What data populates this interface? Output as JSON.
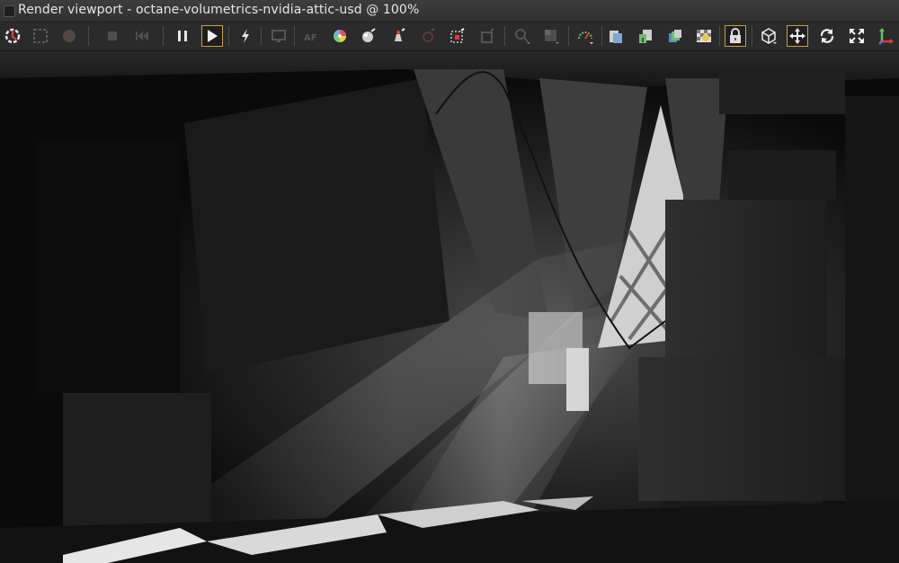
{
  "window": {
    "title": "Render viewport - octane-volumetrics-nvidia-attic-usd @ 100%"
  },
  "toolbar": {
    "buttons": [
      {
        "name": "reset-camera-icon",
        "state": "enabled"
      },
      {
        "name": "region-render-icon",
        "state": "disabled"
      },
      {
        "name": "film-region-icon",
        "state": "disabled"
      },
      {
        "name": "stop-render-icon",
        "state": "disabled"
      },
      {
        "name": "restart-render-icon",
        "state": "disabled"
      },
      {
        "name": "pause-render-icon",
        "state": "enabled"
      },
      {
        "name": "start-render-icon",
        "state": "selected"
      },
      {
        "name": "fast-preview-icon",
        "state": "enabled"
      },
      {
        "name": "display-settings-icon",
        "state": "disabled"
      },
      {
        "name": "autofocus-icon",
        "state": "disabled"
      },
      {
        "name": "white-balance-icon",
        "state": "enabled"
      },
      {
        "name": "material-picker-icon",
        "state": "enabled"
      },
      {
        "name": "object-picker-icon",
        "state": "enabled"
      },
      {
        "name": "light-picker-icon",
        "state": "disabled"
      },
      {
        "name": "render-region-picker-icon",
        "state": "enabled"
      },
      {
        "name": "camera-target-picker-icon",
        "state": "disabled"
      },
      {
        "name": "viewport-resolution-icon",
        "state": "disabled"
      },
      {
        "name": "background-icon",
        "state": "disabled"
      },
      {
        "name": "render-priority-icon",
        "state": "enabled"
      },
      {
        "name": "copy-to-clipboard-icon",
        "state": "enabled"
      },
      {
        "name": "save-render-icon",
        "state": "enabled"
      },
      {
        "name": "export-passes-icon",
        "state": "enabled"
      },
      {
        "name": "alpha-channel-icon",
        "state": "enabled"
      },
      {
        "name": "lock-viewport-icon",
        "state": "selected"
      },
      {
        "name": "object-mode-icon",
        "state": "enabled"
      },
      {
        "name": "translate-gizmo-icon",
        "state": "selected"
      },
      {
        "name": "rotate-gizmo-icon",
        "state": "enabled"
      },
      {
        "name": "scale-gizmo-icon",
        "state": "enabled"
      },
      {
        "name": "world-axis-icon",
        "state": "enabled"
      }
    ]
  },
  "colors": {
    "accent": "#caa23c",
    "titlebar": "#353535",
    "toolbar": "#2b2b2b"
  }
}
